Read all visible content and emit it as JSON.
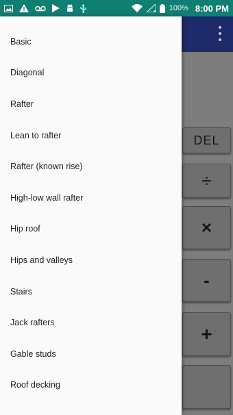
{
  "status_bar": {
    "battery_percent": "100%",
    "time": "8:00 PM",
    "left_icons": [
      "image-icon",
      "warning-icon",
      "voicemail-icon",
      "play-store-icon",
      "android-icon",
      "usb-icon"
    ],
    "right_icons": [
      "wifi-icon",
      "signal-icon",
      "battery-icon"
    ]
  },
  "drawer": {
    "items": [
      {
        "label": "Basic"
      },
      {
        "label": "Diagonal"
      },
      {
        "label": "Rafter"
      },
      {
        "label": "Lean to rafter"
      },
      {
        "label": "Rafter (known rise)"
      },
      {
        "label": "High-low wall rafter"
      },
      {
        "label": "Hip roof"
      },
      {
        "label": "Hips and valleys"
      },
      {
        "label": "Stairs"
      },
      {
        "label": "Jack rafters"
      },
      {
        "label": "Gable studs"
      },
      {
        "label": "Roof decking"
      }
    ]
  },
  "keypad": {
    "del": "DEL",
    "divide": "÷",
    "multiply": "×",
    "minus": "-",
    "plus": "+"
  },
  "colors": {
    "status_bar": "#0e7f72",
    "app_bar": "#1f2a6b",
    "drawer_bg": "#fafafa",
    "scrim_bg": "#7d7d7d"
  }
}
